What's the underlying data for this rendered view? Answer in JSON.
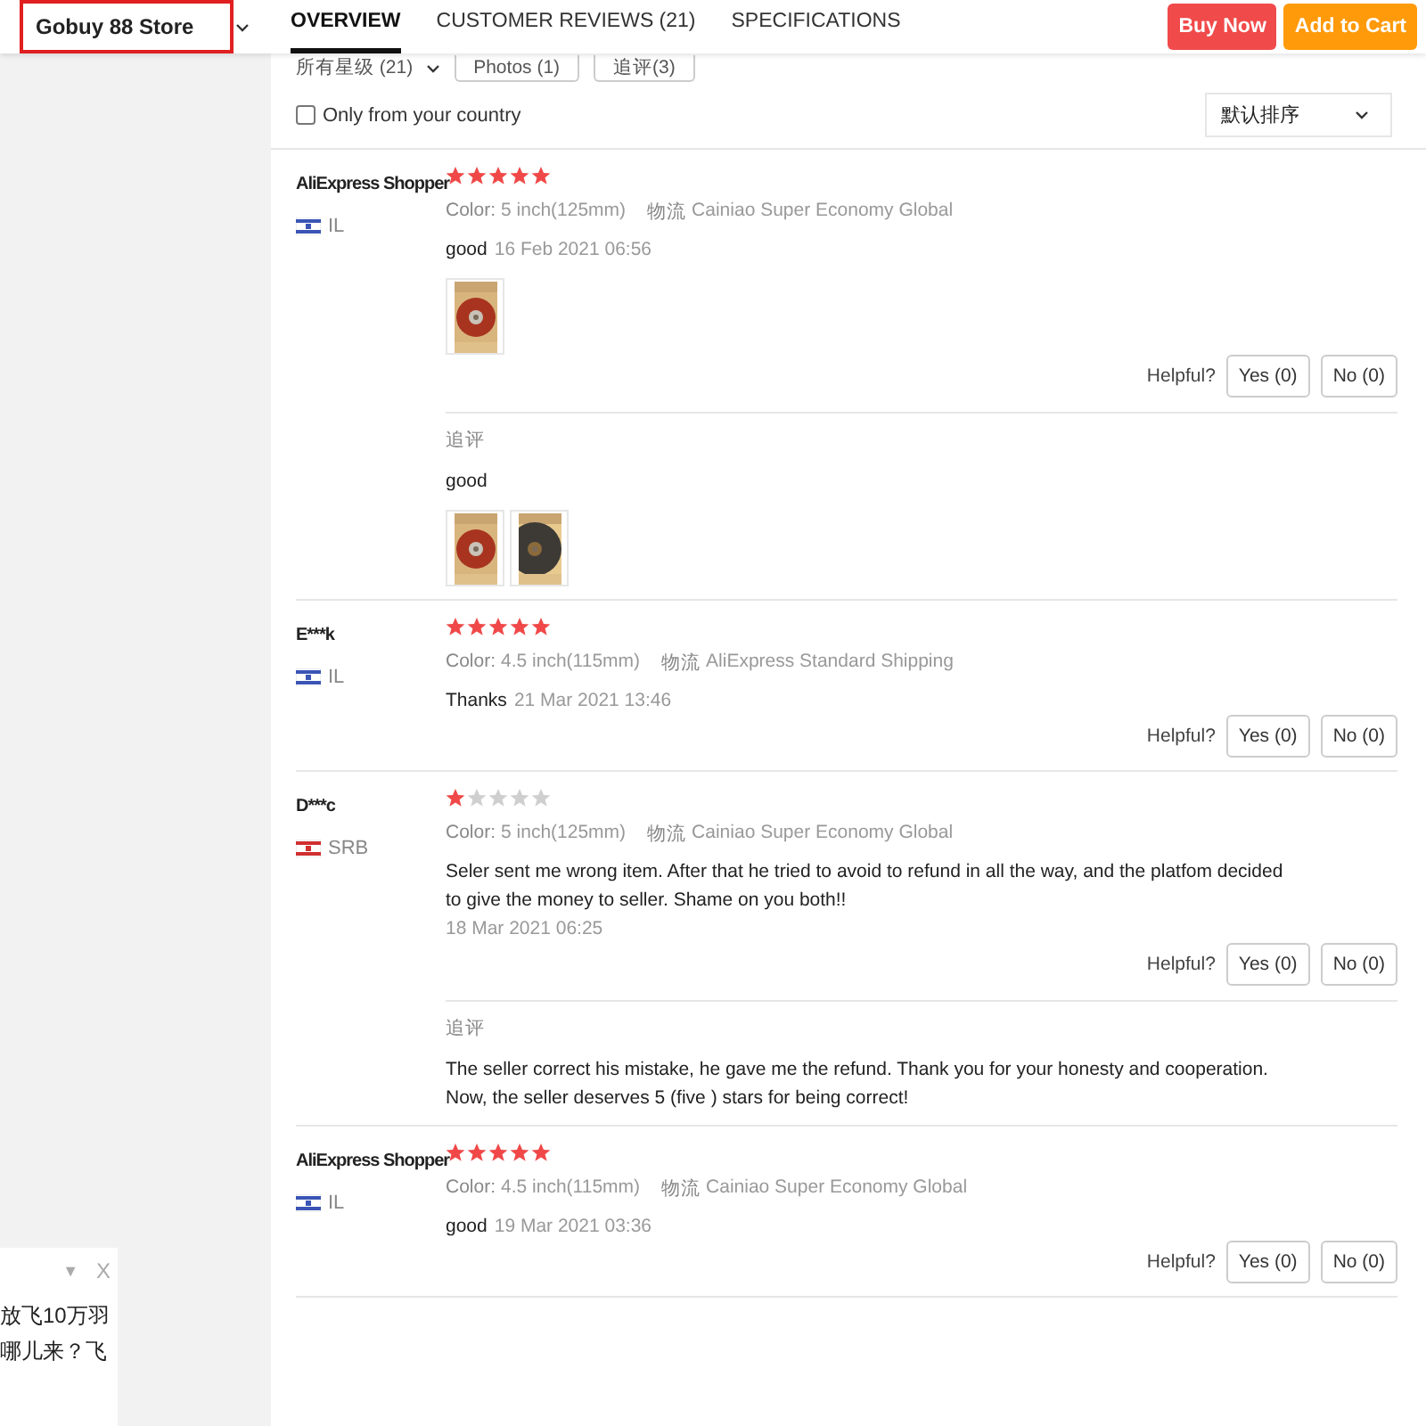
{
  "store_selector": {
    "label": "Gobuy 88 Store"
  },
  "tabs": [
    {
      "label": "OVERVIEW",
      "selected": true
    },
    {
      "label": "CUSTOMER REVIEWS (21)",
      "selected": false
    },
    {
      "label": "SPECIFICATIONS",
      "selected": false
    }
  ],
  "actions": [
    {
      "label": "Buy Now",
      "kind": "buy"
    },
    {
      "label": "Add to Cart",
      "kind": "cart"
    }
  ],
  "filters": [
    {
      "label": "所有星级 (21)",
      "kind": "dropdown"
    },
    {
      "label": "Photos (1)",
      "kind": "button"
    },
    {
      "label": "追评(3)",
      "kind": "button"
    }
  ],
  "country_filter": {
    "label": "Only from your country",
    "checked": false
  },
  "sort": {
    "value": "默认排序"
  },
  "reviews": [
    {
      "name": "AliExpress Shopper",
      "flag": {
        "color": "#3a55b5"
      },
      "country": "IL",
      "stars": 5,
      "variant_label": "Color:",
      "variant": "5 inch(125mm)",
      "shipping_label": "物流",
      "shipping": "Cainiao Super Economy Global",
      "text": "good",
      "date": "16 Feb 2021 06:56",
      "photos": [
        {
          "kind": "picture"
        }
      ],
      "helpful_label": "Helpful?",
      "yes": "Yes (0)",
      "no": "No (0)",
      "followup": {
        "label": "追评",
        "text": "good",
        "photos": [
          {
            "kind": "picture"
          },
          {
            "kind": "picture"
          }
        ]
      }
    },
    {
      "name": "E***k",
      "flag": {
        "color": "#3a55b5"
      },
      "country": "IL",
      "stars": 5,
      "variant_label": "Color:",
      "variant": "4.5 inch(115mm)",
      "shipping_label": "物流",
      "shipping": "AliExpress Standard Shipping",
      "text": "Thanks",
      "date": "21 Mar 2021 13:46",
      "helpful_label": "Helpful?",
      "yes": "Yes (0)",
      "no": "No (0)"
    },
    {
      "name": "D***c",
      "flag": {
        "color": "#d03030"
      },
      "country": "SRB",
      "stars": 1,
      "variant_label": "Color:",
      "variant": "5 inch(125mm)",
      "shipping_label": "物流",
      "shipping": "Cainiao Super Economy Global",
      "text": "Seler sent me wrong item. After that he tried to avoid to refund in all the way, and the platfom decided to give the money to seller. Shame on you both!!",
      "date": "18 Mar 2021 06:25",
      "helpful_label": "Helpful?",
      "yes": "Yes (0)",
      "no": "No (0)",
      "followup": {
        "label": "追评",
        "text": "The seller correct his mistake, he gave me the refund. Thank you for your honesty and cooperation. Now, the seller deserves 5 (five ) stars for being correct!"
      }
    },
    {
      "name": "AliExpress Shopper",
      "flag": {
        "color": "#3a55b5"
      },
      "country": "IL",
      "stars": 5,
      "variant_label": "Color:",
      "variant": "4.5 inch(115mm)",
      "shipping_label": "物流",
      "shipping": "Cainiao Super Economy Global",
      "text": "good",
      "date": "19 Mar 2021 03:36",
      "helpful_label": "Helpful?",
      "yes": "Yes (0)",
      "no": "No (0)"
    }
  ],
  "ad": {
    "menu": "▼",
    "close": "X",
    "lines": [
      "放飞10万羽",
      "哪儿来？飞"
    ]
  }
}
